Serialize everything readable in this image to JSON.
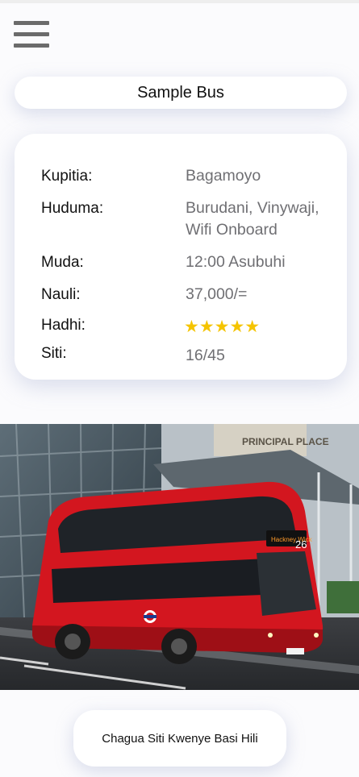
{
  "header": {
    "menu_icon": "hamburger-menu-icon"
  },
  "bus": {
    "name": "Sample Bus"
  },
  "details": {
    "route_label": "Kupitia:",
    "route_value": "Bagamoyo",
    "services_label": "Huduma:",
    "services_line1": "Burudani, Vinywaji,",
    "services_line2": "Wifi Onboard",
    "time_label": "Muda:",
    "time_value": "12:00 Asubuhi",
    "fare_label": "Nauli:",
    "fare_value": "37,000/=",
    "rating_label": "Hadhi:",
    "rating_value": 5,
    "rating_max": 5,
    "rating_stars": "★★★★★",
    "seats_label": "Siti:",
    "seats_value": "16/45"
  },
  "photo": {
    "sign_text": "PRINCIPAL PLACE",
    "route_number": "26",
    "destination": "Hackney Wick"
  },
  "cta": {
    "label": "Chagua Siti Kwenye Basi Hili"
  },
  "colors": {
    "star": "#f5c400",
    "bus_red": "#d3161f",
    "label": "#111111",
    "value": "#6f6f73"
  }
}
